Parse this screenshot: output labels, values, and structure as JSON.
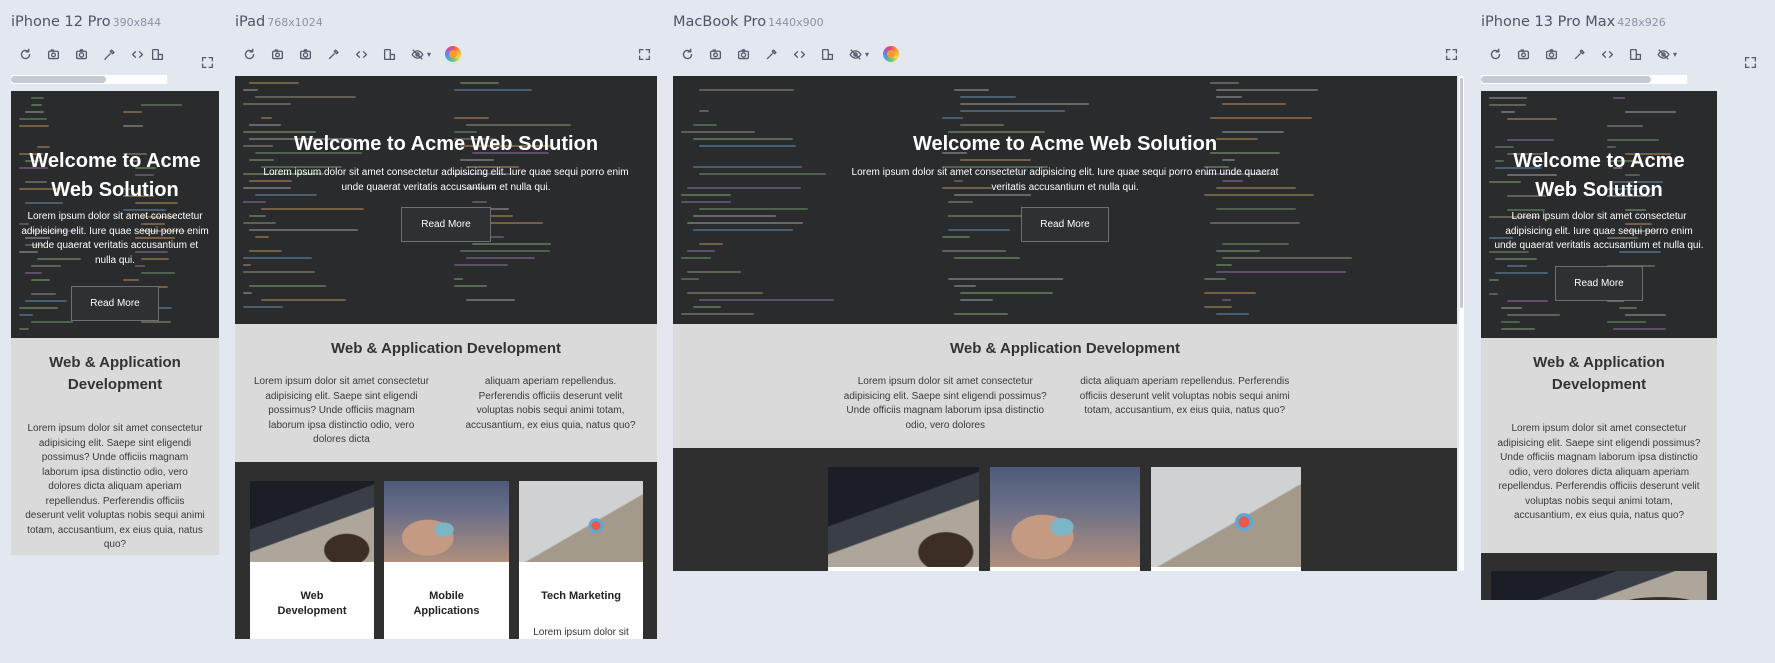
{
  "devices": [
    {
      "name": "iPhone 12 Pro",
      "size": "390x844"
    },
    {
      "name": "iPad",
      "size": "768x1024"
    },
    {
      "name": "MacBook Pro",
      "size": "1440x900"
    },
    {
      "name": "iPhone 13 Pro Max",
      "size": "428x926"
    }
  ],
  "toolbar_icons": [
    "refresh-icon",
    "camera-rotate-icon",
    "screenshot-icon",
    "eyedropper-icon",
    "code-icon",
    "layout-icon",
    "eye-slash-icon",
    "color-wheel-icon"
  ],
  "site": {
    "hero": {
      "title": "Welcome to Acme Web Solution",
      "text": "Lorem ipsum dolor sit amet consectetur adipisicing elit. Iure quae sequi porro enim unde quaerat veritatis accusantium et nulla qui.",
      "button": "Read More"
    },
    "about": {
      "title": "Web & Application Development",
      "text": "Lorem ipsum dolor sit amet consectetur adipisicing elit. Saepe sint eligendi possimus? Unde officiis magnam laborum ipsa distinctio odio, vero dolores dicta aliquam aperiam repellendus. Perferendis officiis deserunt velit voluptas nobis sequi animi totam, accusantium, ex eius quia, natus quo?",
      "col1_ipad": "Lorem ipsum dolor sit amet consectetur adipisicing elit. Saepe sint eligendi possimus? Unde officiis magnam laborum ipsa distinctio odio, vero dolores dicta",
      "col2_ipad": "aliquam aperiam repellendus. Perferendis officiis deserunt velit voluptas nobis sequi animi totam, accusantium, ex eius quia, natus quo?",
      "col1_mac": "Lorem ipsum dolor sit amet consectetur adipisicing elit. Saepe sint eligendi possimus? Unde officiis magnam laborum ipsa distinctio odio, vero dolores",
      "col2_mac": "dicta aliquam aperiam repellendus. Perferendis officiis deserunt velit voluptas nobis sequi animi totam, accusantium, ex eius quia, natus quo?"
    },
    "services": [
      {
        "title": "Web Development",
        "image": "laptop-code-photo"
      },
      {
        "title": "Mobile Applications",
        "image": "phone-photo"
      },
      {
        "title": "Tech Marketing",
        "image": "analytics-laptop-photo",
        "text": "Lorem ipsum dolor sit"
      }
    ]
  },
  "colors": {
    "workspace": "#e2e7f0",
    "hero_bg": "#2a2b2d",
    "about_bg": "#dadada",
    "services_bg": "#2f2f2f"
  }
}
